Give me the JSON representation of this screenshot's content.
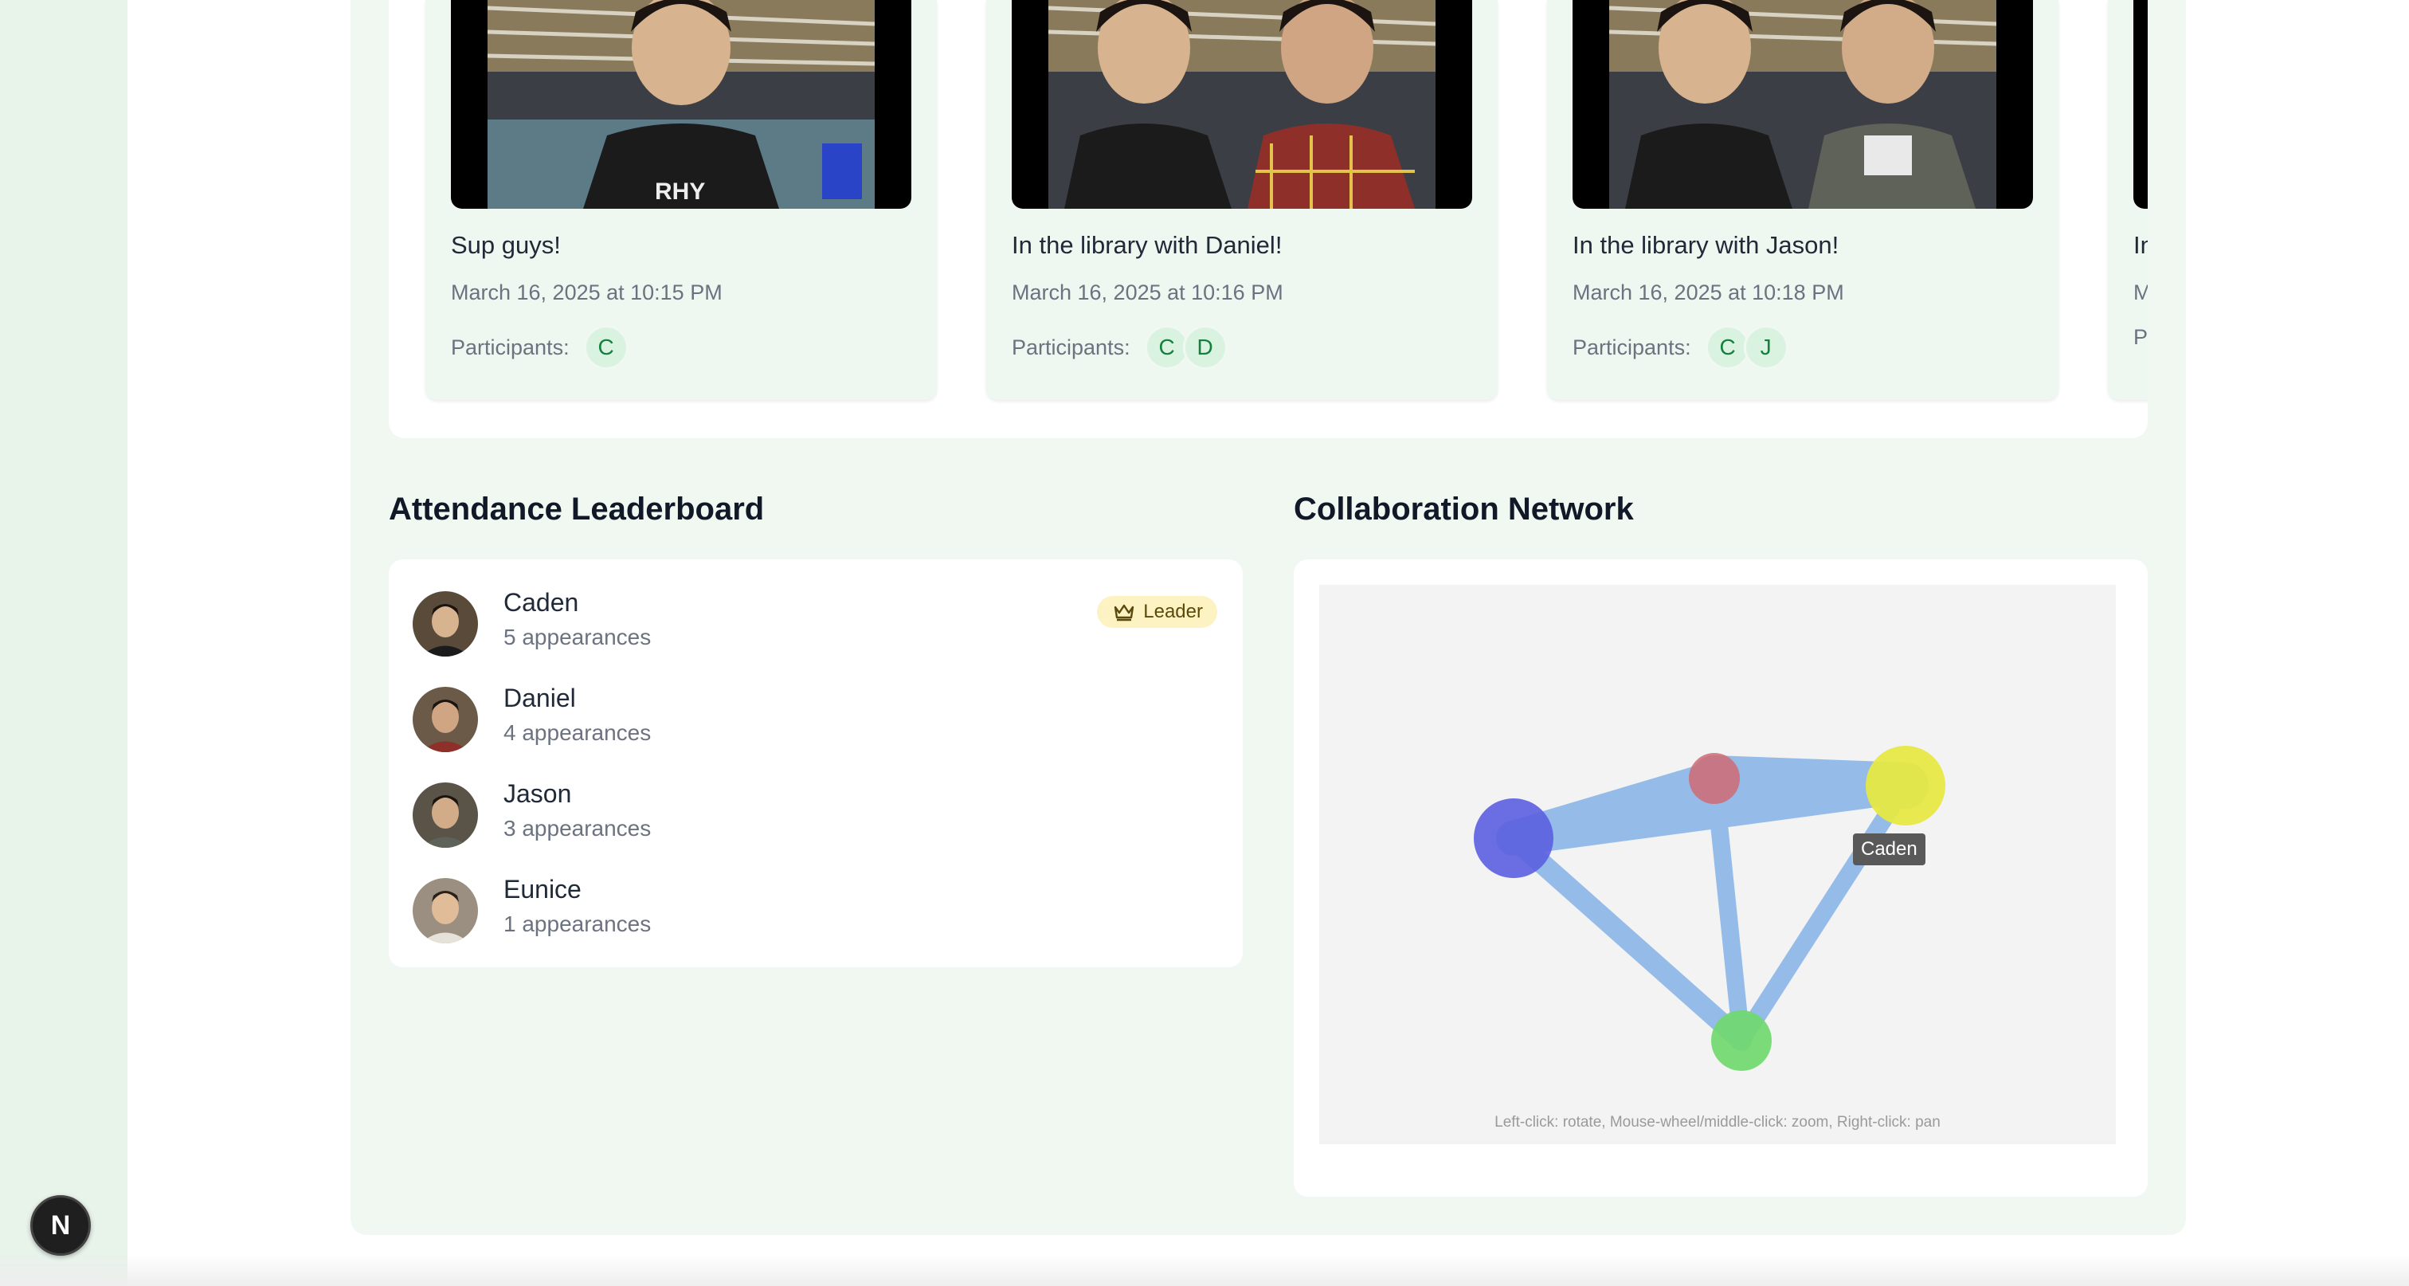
{
  "moments": [
    {
      "caption": "Sup guys!",
      "date": "March 16, 2025 at 10:15 PM",
      "participants_label": "Participants:",
      "participants": [
        "C"
      ]
    },
    {
      "caption": "In the library with Daniel!",
      "date": "March 16, 2025 at 10:16 PM",
      "participants_label": "Participants:",
      "participants": [
        "C",
        "D"
      ]
    },
    {
      "caption": "In the library with Jason!",
      "date": "March 16, 2025 at 10:18 PM",
      "participants_label": "Participants:",
      "participants": [
        "C",
        "J"
      ]
    },
    {
      "caption": "In",
      "date": "M",
      "participants_label": "P"
    }
  ],
  "leaderboard": {
    "title": "Attendance Leaderboard",
    "badge_label": "Leader",
    "badge_icon": "crown-icon",
    "entries": [
      {
        "name": "Caden",
        "count": "5 appearances"
      },
      {
        "name": "Daniel",
        "count": "4 appearances"
      },
      {
        "name": "Jason",
        "count": "3 appearances"
      },
      {
        "name": "Eunice",
        "count": "1 appearances"
      }
    ]
  },
  "network": {
    "title": "Collaboration Network",
    "hint": "Left-click: rotate, Mouse-wheel/middle-click: zoom, Right-click: pan",
    "tooltip": "Caden",
    "node_colors": [
      "#5b5fe0",
      "#cf6a72",
      "#e6e845",
      "#6fd86b"
    ],
    "edge_color": "#4a90e2"
  },
  "nav_badge": "N",
  "colors": {
    "panel": "#f1f8f2",
    "chip": "#d9f3e0",
    "chip_text": "#15803d",
    "leader_badge": "#fdf3c2"
  }
}
